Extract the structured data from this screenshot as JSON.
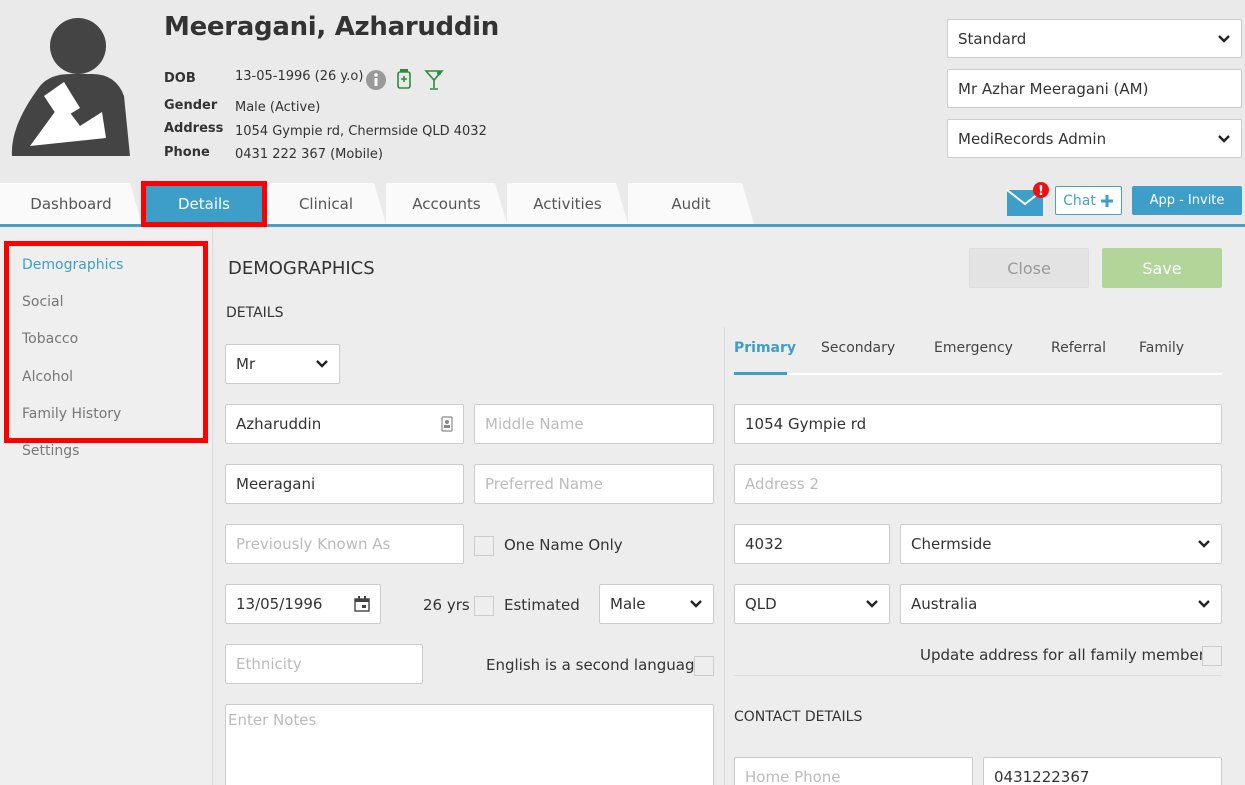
{
  "patient": {
    "name": "Meeragani, Azharuddin",
    "dob_label": "DOB",
    "dob_value": "13-05-1996 (26 y.o)",
    "gender_label": "Gender",
    "gender_value": "Male (Active)",
    "address_label": "Address",
    "address_value": "1054 Gympie rd, Chermside QLD 4032",
    "phone_label": "Phone",
    "phone_value": "0431 222 367 (Mobile)"
  },
  "header_controls": {
    "billing_type": "Standard",
    "doctor": "Mr Azhar Meeragani (AM)",
    "practice": "MediRecords Admin"
  },
  "tabs": [
    {
      "label": "Dashboard"
    },
    {
      "label": "Details",
      "active": true
    },
    {
      "label": "Clinical"
    },
    {
      "label": "Accounts"
    },
    {
      "label": "Activities"
    },
    {
      "label": "Audit"
    }
  ],
  "toolbar": {
    "chat_label": "Chat",
    "invite_label": "App - Invite",
    "mail_badge": "!"
  },
  "sidebar": {
    "items": [
      {
        "label": "Demographics",
        "active": true
      },
      {
        "label": "Social"
      },
      {
        "label": "Tobacco"
      },
      {
        "label": "Alcohol"
      },
      {
        "label": "Family History"
      },
      {
        "label": "Settings"
      }
    ]
  },
  "main": {
    "title": "DEMOGRAPHICS",
    "close_label": "Close",
    "save_label": "Save",
    "details_heading": "DETAILS",
    "contact_heading": "CONTACT DETAILS"
  },
  "form": {
    "title": "Mr",
    "first_name": "Azharuddin",
    "middle_name_placeholder": "Middle Name",
    "last_name": "Meeragani",
    "preferred_name_placeholder": "Preferred Name",
    "previously_known_placeholder": "Previously Known As",
    "one_name_only_label": "One Name Only",
    "dob": "13/05/1996",
    "age": "26 yrs",
    "estimated_label": "Estimated",
    "gender": "Male",
    "ethnicity_placeholder": "Ethnicity",
    "second_language_label": "English is a second language",
    "notes_placeholder": "Enter Notes"
  },
  "address_tabs": [
    {
      "label": "Primary",
      "active": true
    },
    {
      "label": "Secondary"
    },
    {
      "label": "Emergency"
    },
    {
      "label": "Referral"
    },
    {
      "label": "Family"
    }
  ],
  "address": {
    "line1": "1054 Gympie rd",
    "line2_placeholder": "Address 2",
    "postcode": "4032",
    "suburb": "Chermside",
    "state": "QLD",
    "country": "Australia",
    "update_family_label": "Update address for all family members"
  },
  "contact": {
    "home_phone_placeholder": "Home Phone",
    "mobile": "0431222367"
  },
  "colors": {
    "accent": "#3d9fc8",
    "save_disabled": "#b2d59a",
    "highlight": "#ff0000"
  }
}
